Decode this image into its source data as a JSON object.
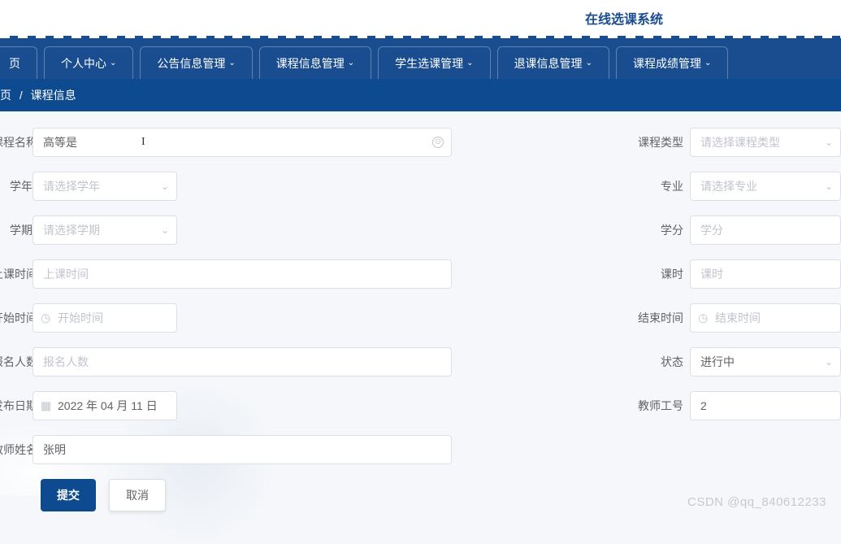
{
  "header": {
    "title": "在线选课系统"
  },
  "nav": {
    "items": [
      {
        "label": "页"
      },
      {
        "label": "个人中心"
      },
      {
        "label": "公告信息管理"
      },
      {
        "label": "课程信息管理"
      },
      {
        "label": "学生选课管理"
      },
      {
        "label": "退课信息管理"
      },
      {
        "label": "课程成绩管理"
      }
    ]
  },
  "breadcrumb": {
    "home": "页",
    "current": "课程信息"
  },
  "form": {
    "course_name": {
      "label": "课程名称",
      "value": "高等是"
    },
    "course_type": {
      "label": "课程类型",
      "placeholder": "请选择课程类型"
    },
    "year": {
      "label": "学年",
      "placeholder": "请选择学年"
    },
    "major": {
      "label": "专业",
      "placeholder": "请选择专业"
    },
    "semester": {
      "label": "学期",
      "placeholder": "请选择学期"
    },
    "credit": {
      "label": "学分",
      "placeholder": "学分"
    },
    "class_time": {
      "label": "上课时间",
      "placeholder": "上课时间"
    },
    "hours": {
      "label": "课时",
      "placeholder": "课时"
    },
    "start_time": {
      "label": "开始时间",
      "placeholder": "开始时间"
    },
    "end_time": {
      "label": "结束时间",
      "placeholder": "结束时间"
    },
    "enroll_count": {
      "label": "报名人数",
      "placeholder": "报名人数"
    },
    "status": {
      "label": "状态",
      "value": "进行中"
    },
    "publish_date": {
      "label": "发布日期",
      "value": "2022 年 04 月 11 日"
    },
    "teacher_id": {
      "label": "教师工号",
      "value": "2"
    },
    "teacher_name": {
      "label": "教师姓名",
      "value": "张明"
    }
  },
  "buttons": {
    "submit": "提交",
    "cancel": "取消"
  },
  "watermark": "CSDN @qq_840612233"
}
